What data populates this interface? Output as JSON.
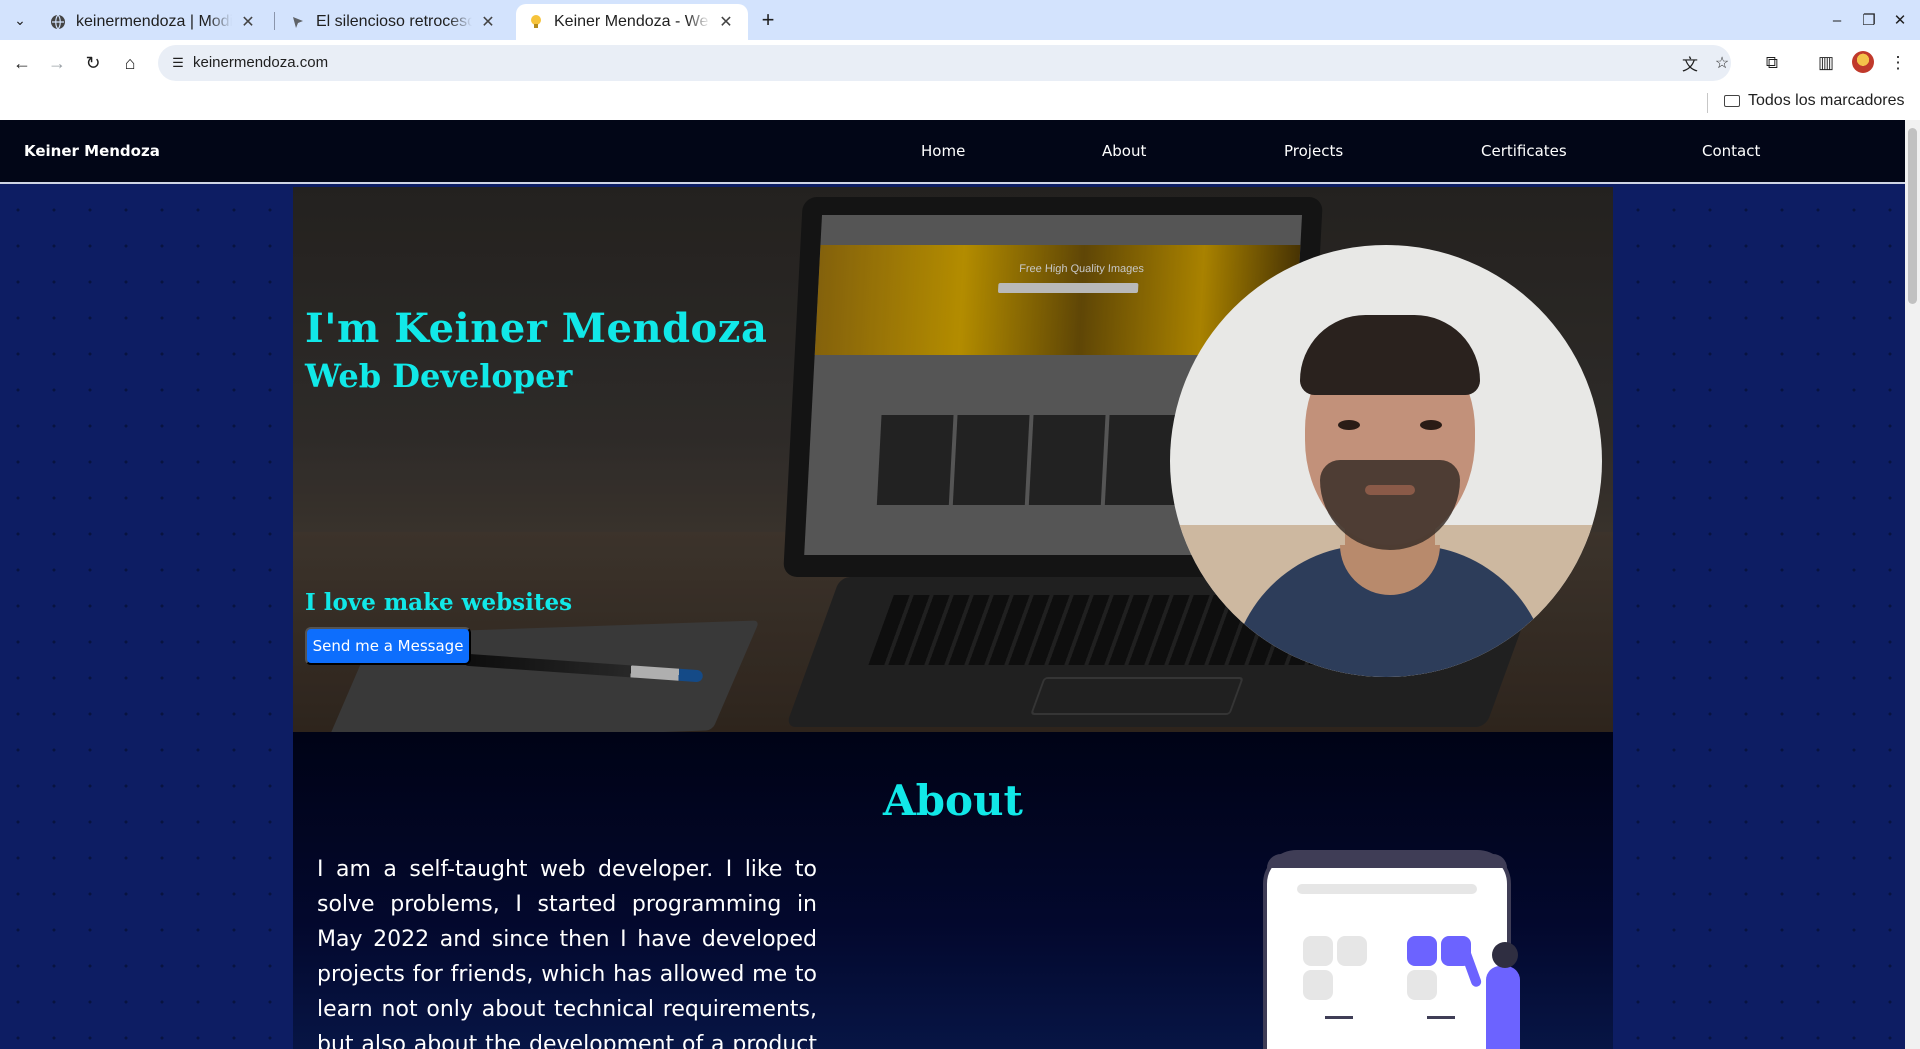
{
  "browser": {
    "tabs": [
      {
        "title": "keinermendoza | Modifi",
        "favicon": "globe-icon",
        "active": false
      },
      {
        "title": "El silencioso retroceso d",
        "favicon": "site-icon",
        "active": false
      },
      {
        "title": "Keiner Mendoza - Web D",
        "favicon": "lightbulb-icon",
        "active": true
      }
    ],
    "url": "keinermendoza.com",
    "bookmarks_folder_label": "Todos los marcadores",
    "glyphs": {
      "tab_list": "⌄",
      "close": "✕",
      "new_tab": "+",
      "minimize": "–",
      "restore": "❐",
      "close_window": "✕",
      "back": "←",
      "forward": "→",
      "reload": "↻",
      "home": "⌂",
      "site_info": "☰",
      "translate": "文",
      "star": "☆",
      "extensions": "⧉",
      "side_panel": "▥",
      "menu": "⋮"
    }
  },
  "site": {
    "brand": "Keiner Mendoza",
    "nav": [
      "Home",
      "About",
      "Projects",
      "Certificates",
      "Contact"
    ],
    "hero": {
      "title": "I'm Keiner Mendoza",
      "subtitle": "Web Developer",
      "tagline": "I love make websites",
      "cta": "Send me a Message",
      "laptop_screen_title": "Free High Quality Images"
    },
    "about": {
      "title": "About",
      "text": "I am a self-taught web developer. I like to solve problems, I started programming in May 2022 and since then I have developed projects for friends, which has allowed me to learn not only about technical requirements, but also about the development of a product concept. I am"
    },
    "colors": {
      "accent_cyan": "#11e8e8",
      "button_blue": "#0d6efd",
      "page_bg": "#0d1d63",
      "nav_bg": "#020617",
      "illustration_purple": "#6c63ff"
    }
  }
}
